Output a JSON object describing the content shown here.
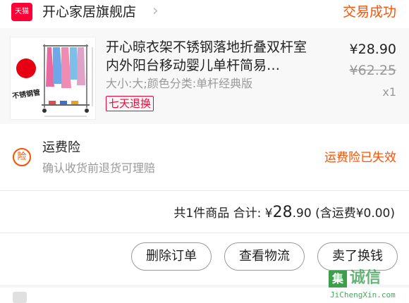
{
  "shop": {
    "badge": "天猫",
    "name": "开心家居旗舰店",
    "status": "交易成功"
  },
  "item": {
    "title": "开心晾衣架不锈钢落地折叠双杆室内外阳台移动婴儿单杆简易…",
    "sku": "大小:大;颜色分类:单杆经典版",
    "return_tag": "七天退换",
    "price": "¥28.90",
    "original_price": "¥62.25",
    "quantity": "x1",
    "thumb_label": "不锈钢管"
  },
  "insurance": {
    "icon_char": "险",
    "title": "运费险",
    "description": "确认收货前退货可理赔",
    "status": "运费险已失效"
  },
  "summary": {
    "count_text": "共1件商品",
    "total_label": "合计:",
    "currency": "¥",
    "total_int": "28",
    "total_dec": ".90",
    "shipping_text": "(含运费¥0.00)"
  },
  "actions": {
    "delete_label": "删除订单",
    "logistics_label": "查看物流",
    "resell_label": "卖了换钱"
  },
  "watermark": {
    "box_char": "集",
    "text": "诚信",
    "url": "JiChengXin.com"
  },
  "colors": {
    "accent": "#ff5000",
    "tmall": "#ff0036"
  }
}
